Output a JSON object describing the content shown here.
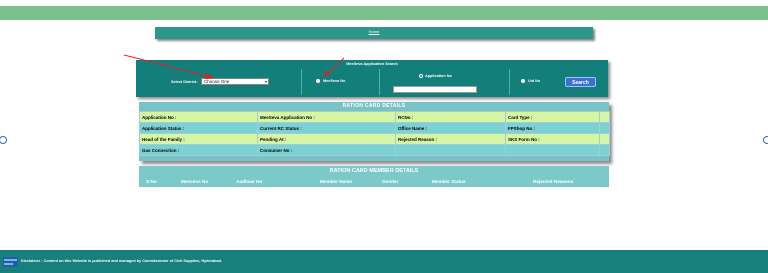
{
  "header": {
    "home_link": "Home"
  },
  "search_panel": {
    "title": "MeeSeva Application Search",
    "district_label": "Select District:",
    "district_select": "Choose One",
    "radio_meeseva": "MeeSeva No",
    "radio_application": "Application No",
    "radio_uid": "Uid No",
    "search_button": "Search",
    "selected_option": "Application No"
  },
  "rc_details": {
    "title": "RATION CARD DETAILS",
    "rows": [
      [
        "Application No :",
        "MeeSeva Application No :",
        "RCNo :",
        "Card Type :"
      ],
      [
        "Application Status :",
        "Current RC Status :",
        "Office Name :",
        "FPShop No :"
      ],
      [
        "Head of the Family :",
        "Pending At :",
        "Rejected Reason :",
        "SKS Form No :"
      ],
      [
        "Gas Connection :",
        "Consumer No :",
        "",
        ""
      ]
    ]
  },
  "member_details": {
    "title": "RATION CARD MEMBER DETAILS",
    "columns": [
      "S No",
      "Meeseva No",
      "Aadhaar No",
      "Member Name",
      "Gender",
      "Member Status",
      "Rejected Reasons"
    ]
  },
  "footer": {
    "text": "Disclaimer : Content on this Website is published and managed by Commissioner of Civil Supplies, Hyderabad."
  },
  "colors": {
    "topbar": "#79c08c",
    "panel": "#127f7a",
    "row_odd": "#d6f5a5",
    "row_even": "#7bd1d4",
    "footer": "#17807d",
    "search_button": "#3d6fd0"
  }
}
